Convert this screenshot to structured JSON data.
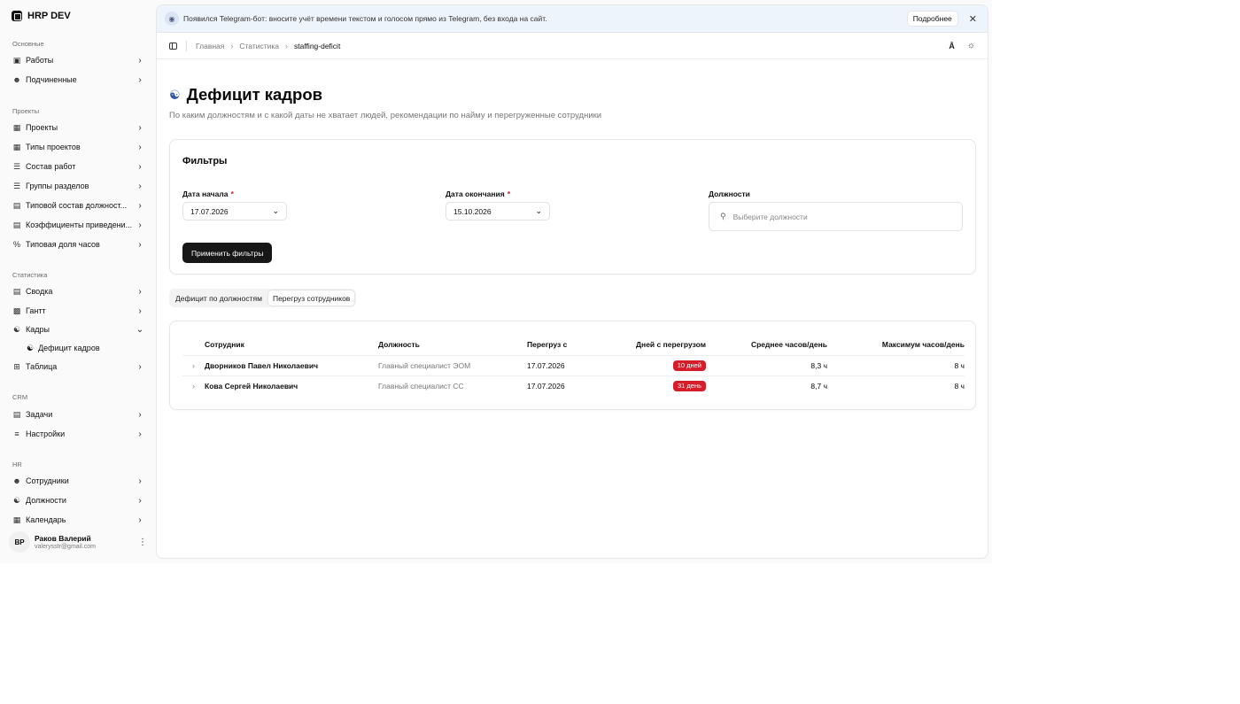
{
  "sidebar": {
    "brand": "HRP DEV",
    "groups": [
      {
        "label": "Основные",
        "items": [
          {
            "label": "Работы"
          },
          {
            "label": "Подчиненные"
          }
        ]
      },
      {
        "label": "Проекты",
        "items": [
          {
            "label": "Проекты"
          },
          {
            "label": "Типы проектов"
          },
          {
            "label": "Состав работ"
          },
          {
            "label": "Группы разделов"
          },
          {
            "label": "Типовой состав должност..."
          },
          {
            "label": "Коэффициенты приведени..."
          },
          {
            "label": "Типовая доля часов"
          }
        ]
      },
      {
        "label": "Статистика",
        "items": [
          {
            "label": "Сводка"
          },
          {
            "label": "Гантт"
          },
          {
            "label": "Кадры"
          },
          {
            "label": "Таблица"
          }
        ],
        "sub_item": "Дефицит кадров"
      },
      {
        "label": "CRM",
        "items": [
          {
            "label": "Задачи"
          },
          {
            "label": "Настройки"
          }
        ]
      },
      {
        "label": "HR",
        "items": [
          {
            "label": "Сотрудники"
          },
          {
            "label": "Должности"
          },
          {
            "label": "Календарь"
          }
        ]
      }
    ],
    "user": {
      "initials": "ВР",
      "name": "Раков Валерий",
      "email": "valerysstr@gmail.com"
    }
  },
  "banner": {
    "text": "Появился Telegram-бот: вносите учёт времени текстом и голосом прямо из Telegram, без входа на сайт.",
    "button": "Подробнее"
  },
  "breadcrumb": [
    "Главная",
    "Статистика",
    "staffing-deficit"
  ],
  "page": {
    "title": "Дефицит кадров",
    "description": "По каким должностям и с какой даты не хватает людей, рекомендации по найму и перегруженные сотрудники"
  },
  "filters": {
    "title": "Фильтры",
    "start_label": "Дата начала",
    "start_value": "17.07.2026",
    "end_label": "Дата окончания",
    "end_value": "15.10.2026",
    "positions_label": "Должности",
    "positions_placeholder": "Выберите должности",
    "required_mark": "*",
    "apply": "Применить фильтры"
  },
  "tabs": [
    {
      "label": "Дефицит по должностям",
      "active": false
    },
    {
      "label": "Перегруз сотрудников",
      "active": true
    }
  ],
  "table": {
    "columns": [
      "Сотрудник",
      "Должность",
      "Перегруз с",
      "Дней с перегрузом",
      "Среднее часов/день",
      "Максимум часов/день"
    ],
    "rows": [
      {
        "employee": "Дворников Павел Николаевич",
        "position": "Главный специалист ЭОМ",
        "since": "17.07.2026",
        "days": "10 дней",
        "avg": "8,3 ч",
        "max": "8 ч"
      },
      {
        "employee": "Кова Сергей Николаевич",
        "position": "Главный специалист СС",
        "since": "17.07.2026",
        "days": "31 день",
        "avg": "8,7 ч",
        "max": "8 ч"
      }
    ]
  },
  "colors": {
    "accent": "#171717",
    "badge": "#d61d2a",
    "banner": "#eef4fb"
  }
}
